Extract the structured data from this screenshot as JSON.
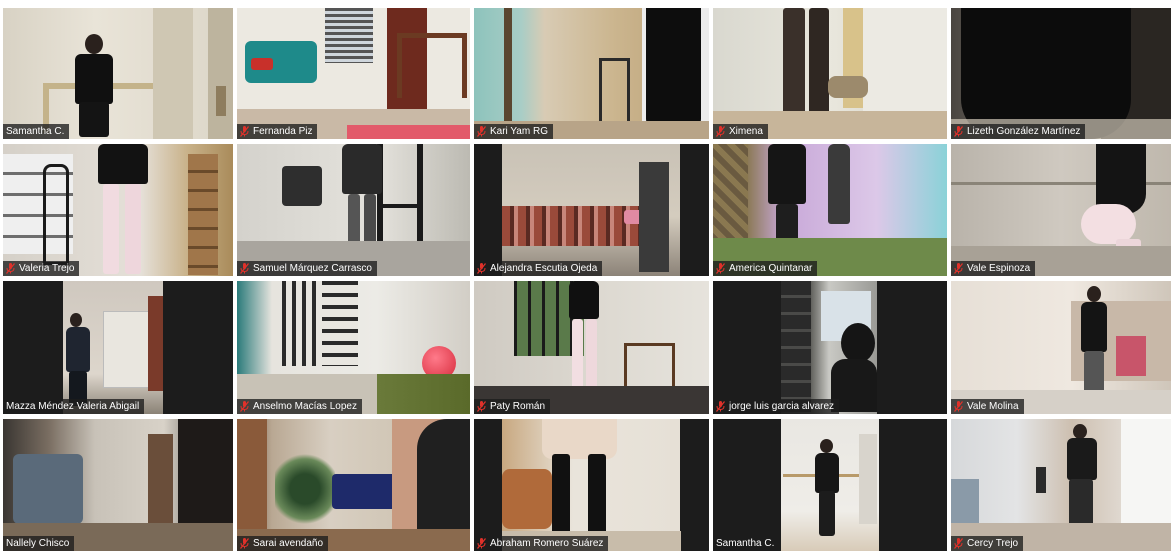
{
  "participants": [
    {
      "name": "Samantha C.",
      "muted": false,
      "active_speaker": true
    },
    {
      "name": "Fernanda Piz",
      "muted": true,
      "active_speaker": false
    },
    {
      "name": "Kari Yam RG",
      "muted": true,
      "active_speaker": false
    },
    {
      "name": "Ximena",
      "muted": true,
      "active_speaker": false
    },
    {
      "name": "Lizeth González Martínez",
      "muted": true,
      "active_speaker": false
    },
    {
      "name": "Valeria Trejo",
      "muted": true,
      "active_speaker": false
    },
    {
      "name": "Samuel Márquez Carrasco",
      "muted": true,
      "active_speaker": false
    },
    {
      "name": "Alejandra Escutia Ojeda",
      "muted": true,
      "active_speaker": false
    },
    {
      "name": "America Quintanar",
      "muted": true,
      "active_speaker": false
    },
    {
      "name": "Vale Espinoza",
      "muted": true,
      "active_speaker": false
    },
    {
      "name": "Mazza Méndez Valeria Abigail",
      "muted": false,
      "active_speaker": false
    },
    {
      "name": "Anselmo Macías Lopez",
      "muted": true,
      "active_speaker": false
    },
    {
      "name": "Paty Román",
      "muted": true,
      "active_speaker": false
    },
    {
      "name": "jorge luis garcia alvarez",
      "muted": true,
      "active_speaker": false
    },
    {
      "name": "Vale Molina",
      "muted": true,
      "active_speaker": false
    },
    {
      "name": "Nallely Chisco",
      "muted": false,
      "active_speaker": false
    },
    {
      "name": "Sarai avendaño",
      "muted": true,
      "active_speaker": false
    },
    {
      "name": "Abraham Romero Suárez",
      "muted": true,
      "active_speaker": false
    },
    {
      "name": "Samantha C.",
      "muted": false,
      "active_speaker": false
    },
    {
      "name": "Cercy Trejo",
      "muted": true,
      "active_speaker": false
    }
  ],
  "colors": {
    "active_border": "#c8e000",
    "muted_icon": "#e0312a",
    "label_bg": "#1c1c1c"
  },
  "icons": {
    "muted": "mic-muted-icon"
  }
}
